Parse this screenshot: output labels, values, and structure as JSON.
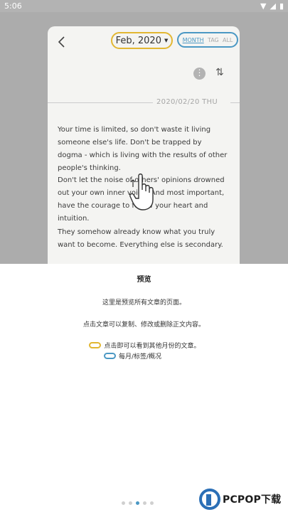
{
  "statusbar": {
    "time": "5:06"
  },
  "header": {
    "month": "Feb, 2020",
    "view_tabs": [
      "MONTH",
      "TAG",
      "ALL"
    ]
  },
  "entry": {
    "date": "2020/02/20 THU",
    "paragraphs": [
      "Your time is limited, so don't waste it living someone else's life. Don't be trapped by dogma - which is living with the results of other people's thinking.",
      "Don't let the noise of others' opinions drowned out your own inner voice. And most important, have the courage to follow your heart and intuition.",
      "They somehow already know what you truly want to become. Everything else is secondary."
    ]
  },
  "sheet": {
    "title": "预览",
    "line1": "这里是预览所有文章的页面。",
    "line2": "点击文章可以复制、修改或删除正文内容。",
    "legend_month": "点击即可以看到其他月份的文章。",
    "legend_view": "每月/标签/概况"
  },
  "pager": {
    "count": 5,
    "active": 2
  },
  "watermark": {
    "text": "PCPOP下载"
  },
  "colors": {
    "month_accent": "#e2b732",
    "view_accent": "#4b98c4"
  }
}
